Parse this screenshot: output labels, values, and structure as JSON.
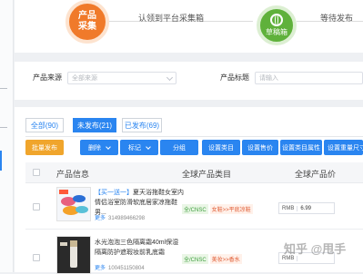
{
  "steps": {
    "step1_label": "产品\n采集",
    "step1_connector": "认领到平台采集箱",
    "step2_label": "草稿箱",
    "step2_connector": "等待发布"
  },
  "filters": {
    "source_label": "产品来源",
    "source_value": "全部来源",
    "title_label": "产品标题",
    "title_placeholder": "请输入"
  },
  "tabs": [
    {
      "label": "全部(90)"
    },
    {
      "label": "未发布(21)"
    },
    {
      "label": "已发布(69)"
    }
  ],
  "toolbar": {
    "batch_publish": "批量发布",
    "delete": "删除",
    "tag": "标记",
    "group": "分组",
    "set_category": "设置类目",
    "set_price": "设置售价",
    "set_category_attr": "设置类目属性",
    "set_weight": "设置重量尺寸"
  },
  "table": {
    "headers": {
      "product_info": "产品信息",
      "global_category": "全球产品类目",
      "global_price": "全球产品价"
    },
    "rows": [
      {
        "title_tag": "【买一送一】",
        "title_rest": "夏天浴拖鞋女室内情侣浴室防滑软底居家凉拖鞋男...",
        "more": "更多",
        "id": "314989466298",
        "country": "全/CNSC",
        "category_path": "女鞋>>平底凉鞋",
        "currency": "RMB",
        "price": "6.99"
      },
      {
        "title_tag": "",
        "title_rest": "水光泡泡三色隔离霜40ml保湿隔离防护遮瑕妆前乳底霜",
        "more": "更多",
        "id": "100451150804",
        "country": "全/CNSC",
        "category_path": "美妆>>香水",
        "currency": "RMB",
        "price": ""
      }
    ]
  },
  "watermark": "知乎 @甩手"
}
